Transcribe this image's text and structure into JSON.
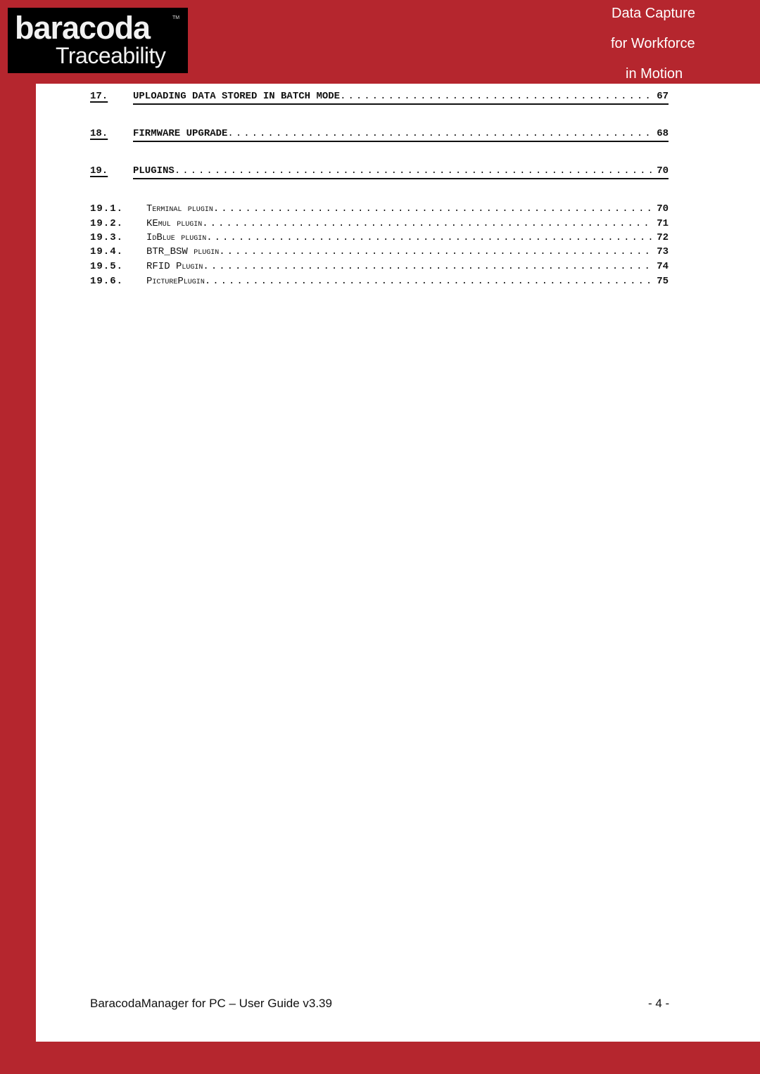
{
  "header": {
    "logo_brand": "baracoda",
    "logo_tm": "TM",
    "logo_sub": "Traceability",
    "tagline": [
      "Data Capture",
      "for Workforce",
      "in Motion"
    ],
    "accent_color": "#b5262e"
  },
  "toc": {
    "main": [
      {
        "num": "17.",
        "title": "UPLOADING DATA STORED IN BATCH MODE",
        "page": "67"
      },
      {
        "num": "18.",
        "title": "FIRMWARE UPGRADE",
        "page": "68"
      },
      {
        "num": "19.",
        "title": "PLUGINS",
        "page": "70"
      }
    ],
    "sub": [
      {
        "num": "19.1.",
        "title": "Terminal plugin",
        "page": "70"
      },
      {
        "num": "19.2.",
        "title": "KEmul plugin",
        "page": "71"
      },
      {
        "num": "19.3.",
        "title": "IdBlue plugin",
        "page": "72"
      },
      {
        "num": "19.4.",
        "title": "BTR_BSW plugin",
        "page": "73"
      },
      {
        "num": "19.5.",
        "title": "RFID Plugin",
        "page": "74"
      },
      {
        "num": "19.6.",
        "title": "PicturePlugin",
        "page": "75"
      }
    ]
  },
  "footer": {
    "title": "BaracodaManager for PC – User Guide v3.39",
    "page": "- 4 -"
  }
}
